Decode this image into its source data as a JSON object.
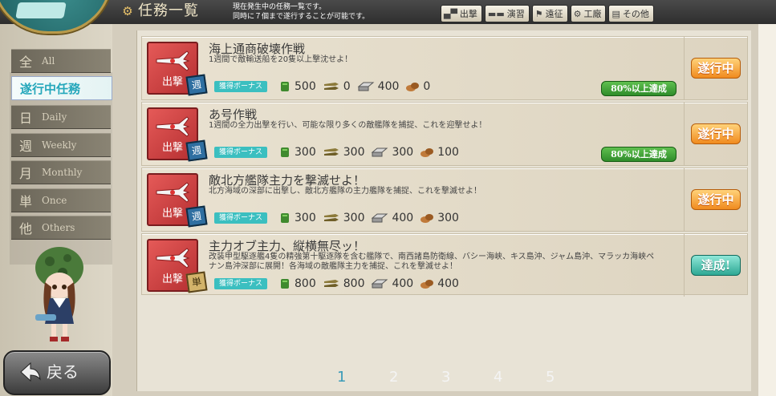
{
  "header": {
    "title": "任務一覧",
    "subtitle_line1": "現在発生中の任務一覧です。",
    "subtitle_line2": "同時に７個まで遂行することが可能です。",
    "nav_tabs": [
      {
        "label": "出撃",
        "icon": "sortie-icon"
      },
      {
        "label": "演習",
        "icon": "exercise-icon"
      },
      {
        "label": "遠征",
        "icon": "expedition-icon"
      },
      {
        "label": "工廠",
        "icon": "arsenal-icon"
      },
      {
        "label": "その他",
        "icon": "other-icon"
      }
    ]
  },
  "filters": {
    "all": {
      "kanji": "全",
      "label": "All"
    },
    "active": {
      "label": "遂行中任務"
    },
    "daily": {
      "kanji": "日",
      "label": "Daily"
    },
    "weekly": {
      "kanji": "週",
      "label": "Weekly"
    },
    "monthly": {
      "kanji": "月",
      "label": "Monthly"
    },
    "once": {
      "kanji": "単",
      "label": "Once"
    },
    "others": {
      "kanji": "他",
      "label": "Others"
    }
  },
  "quests": [
    {
      "category": "出撃",
      "frequency": "週",
      "title": "海上通商破壊作戦",
      "description": "1週間で敵輸送船を20隻以上撃沈せよ！",
      "bonus_label": "獲得ボーナス",
      "fuel": "500",
      "ammo": "0",
      "steel": "400",
      "bauxite": "0",
      "progress": "80%以上達成",
      "status": "遂行中"
    },
    {
      "category": "出撃",
      "frequency": "週",
      "title": "あ号作戦",
      "description": "1週間の全力出撃を行い、可能な限り多くの敵艦隊を捕捉、これを迎撃せよ！",
      "bonus_label": "獲得ボーナス",
      "fuel": "300",
      "ammo": "300",
      "steel": "300",
      "bauxite": "100",
      "progress": "80%以上達成",
      "status": "遂行中"
    },
    {
      "category": "出撃",
      "frequency": "週",
      "title": "敵北方艦隊主力を撃滅せよ！",
      "description": "北方海域の深部に出撃し、敵北方艦隊の主力艦隊を捕捉、これを撃滅せよ！",
      "bonus_label": "獲得ボーナス",
      "fuel": "300",
      "ammo": "300",
      "steel": "400",
      "bauxite": "300",
      "progress": "",
      "status": "遂行中"
    },
    {
      "category": "出撃",
      "frequency": "単",
      "title": "主力オブ主力、縦横無尽ッ！",
      "description": "改装甲型駆逐艦4隻の精強第十駆逐隊を含む艦隊で、南西諸島防衛線、バシー海峡、キス島沖、ジャム島沖、マラッカ海峡ペナン島沖深部に展開！各海域の敵艦隊主力を捕捉、これを撃滅せよ！",
      "bonus_label": "獲得ボーナス",
      "fuel": "800",
      "ammo": "800",
      "steel": "400",
      "bauxite": "400",
      "progress": "",
      "status": "達成!"
    }
  ],
  "pager": {
    "pages": [
      "1",
      "2",
      "3",
      "4",
      "5"
    ],
    "current": "1"
  },
  "back_button": {
    "label": "戻る"
  },
  "colors": {
    "accent": "#3a9bb8",
    "in_progress": "#f08a1e",
    "complete": "#2ea894",
    "bonus": "#3bbfc0"
  }
}
